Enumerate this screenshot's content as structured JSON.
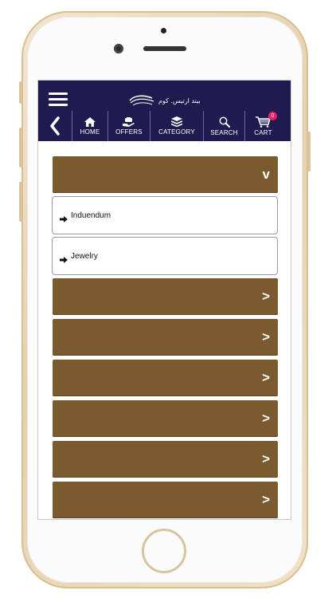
{
  "header": {
    "logo_text": "بيند ارتيس. كوم"
  },
  "nav": {
    "back_label": "<",
    "items": [
      {
        "label": "HOME",
        "icon": "home-icon"
      },
      {
        "label": "OFFERS",
        "icon": "offers-icon"
      },
      {
        "label": "CATEGORY",
        "icon": "layers-icon"
      },
      {
        "label": "SEARCH",
        "icon": "search-icon"
      },
      {
        "label": "CART",
        "icon": "cart-icon"
      }
    ],
    "cart_count": "0"
  },
  "categories": [
    {
      "expanded": true,
      "chevron": "v"
    },
    {
      "expanded": false,
      "chevron": ">"
    },
    {
      "expanded": false,
      "chevron": ">"
    },
    {
      "expanded": false,
      "chevron": ">"
    },
    {
      "expanded": false,
      "chevron": ">"
    },
    {
      "expanded": false,
      "chevron": ">"
    },
    {
      "expanded": false,
      "chevron": ">"
    }
  ],
  "subcategories": [
    {
      "label": "Induendum"
    },
    {
      "label": "Jewelry"
    }
  ],
  "colors": {
    "header_bg": "#1f1a4f",
    "category_bg": "#7b5a2f",
    "badge": "#e61f63"
  }
}
